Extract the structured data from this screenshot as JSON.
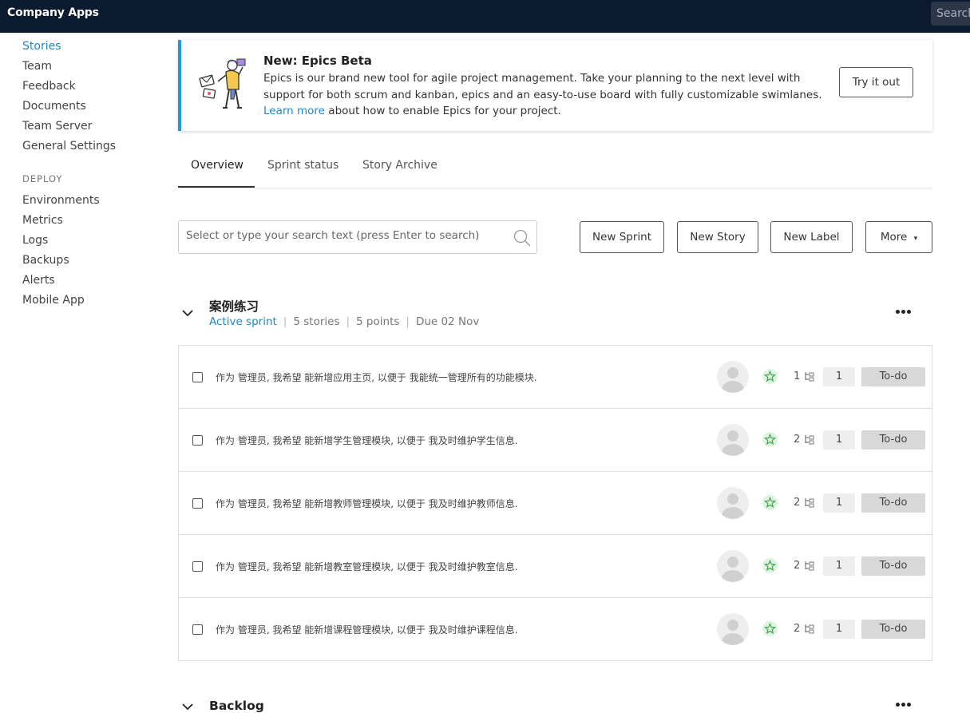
{
  "app": {
    "title": "Company Apps",
    "search_label": "Search"
  },
  "sidebar": {
    "items": [
      {
        "label": "Stories"
      },
      {
        "label": "Team"
      },
      {
        "label": "Feedback"
      },
      {
        "label": "Documents"
      },
      {
        "label": "Team Server"
      },
      {
        "label": "General Settings"
      }
    ],
    "deploy_heading": "DEPLOY",
    "deploy_items": [
      {
        "label": "Environments"
      },
      {
        "label": "Metrics"
      },
      {
        "label": "Logs"
      },
      {
        "label": "Backups"
      },
      {
        "label": "Alerts"
      },
      {
        "label": "Mobile App"
      }
    ]
  },
  "banner": {
    "title": "New: Epics Beta",
    "text": "Epics is our brand new tool for agile project management. Take your planning to the next level with support for both scrum and kanban, epics and an easy-to-use board with fully customizable swimlanes.",
    "link_label": "Learn more",
    "link_suffix": "about how to enable Epics for your project.",
    "button_label": "Try it out"
  },
  "tabs": [
    {
      "label": "Overview"
    },
    {
      "label": "Sprint status"
    },
    {
      "label": "Story Archive"
    }
  ],
  "toolbar": {
    "search_placeholder": "Select or type your search text (press Enter to search)",
    "new_sprint": "New Sprint",
    "new_story": "New Story",
    "new_label": "New Label",
    "more": "More",
    "more_caret": "▾"
  },
  "sprint": {
    "title": "案例练习",
    "status": "Active sprint",
    "stories": "5 stories",
    "points": "5 points",
    "due": "Due 02 Nov",
    "separator": "|"
  },
  "stories": [
    {
      "text": "作为 管理员, 我希望 能新增应用主页, 以便于 我能统一管理所有的功能模块.",
      "tasks": "1",
      "points": "1",
      "status": "To-do"
    },
    {
      "text": "作为 管理员, 我希望 能新增学生管理模块, 以便于 我及时维护学生信息.",
      "tasks": "2",
      "points": "1",
      "status": "To-do"
    },
    {
      "text": "作为 管理员, 我希望 能新增教师管理模块, 以便于 我及时维护教师信息.",
      "tasks": "2",
      "points": "1",
      "status": "To-do"
    },
    {
      "text": "作为 管理员, 我希望 能新增教室管理模块, 以便于 我及时维护教室信息.",
      "tasks": "2",
      "points": "1",
      "status": "To-do"
    },
    {
      "text": "作为 管理员, 我希望 能新增课程管理模块, 以便于 我及时维护课程信息.",
      "tasks": "2",
      "points": "1",
      "status": "To-do"
    }
  ],
  "backlog": {
    "title": "Backlog"
  },
  "colors": {
    "accent": "#1e88c7",
    "topbar": "#0b1a2e",
    "banner_border": "#1e9ad6"
  }
}
